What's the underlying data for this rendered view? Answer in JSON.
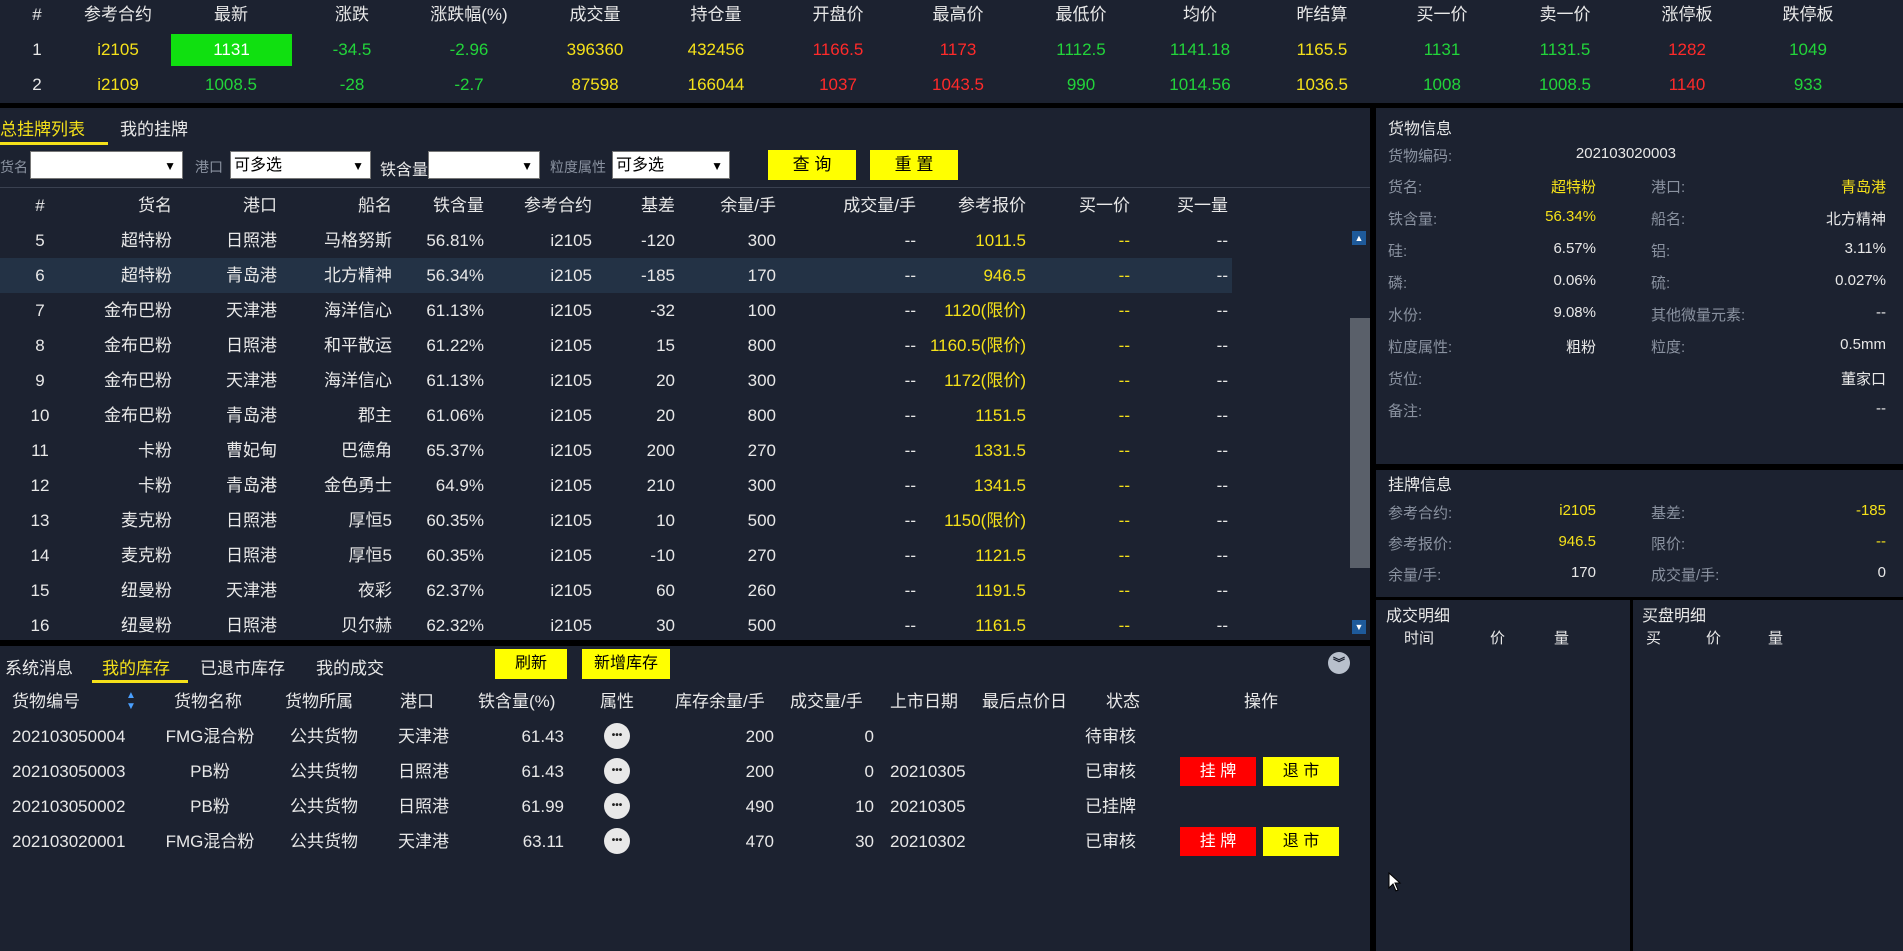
{
  "market": {
    "headers": [
      "#",
      "参考合约",
      "最新",
      "涨跌",
      "涨跌幅(%)",
      "成交量",
      "持仓量",
      "开盘价",
      "最高价",
      "最低价",
      "均价",
      "昨结算",
      "买一价",
      "卖一价",
      "涨停板",
      "跌停板"
    ],
    "rows": [
      [
        "1",
        "i2105",
        "1131",
        "-34.5",
        "-2.96",
        "396360",
        "432456",
        "1166.5",
        "1173",
        "1112.5",
        "1141.18",
        "1165.5",
        "1131",
        "1131.5",
        "1282",
        "1049"
      ],
      [
        "2",
        "i2109",
        "1008.5",
        "-28",
        "-2.7",
        "87598",
        "166044",
        "1037",
        "1043.5",
        "990",
        "1014.56",
        "1036.5",
        "1008",
        "1008.5",
        "1140",
        "933"
      ]
    ]
  },
  "listing": {
    "tabs": [
      "总挂牌列表",
      "我的挂牌"
    ],
    "filters": {
      "goods_label": "货名",
      "port_label": "港口",
      "port_value": "可多选",
      "iron_label": "铁含量",
      "grain_label": "粒度属性",
      "grain_value": "可多选",
      "query": "查 询",
      "reset": "重 置"
    },
    "headers": [
      "#",
      "货名",
      "港口",
      "船名",
      "铁含量",
      "参考合约",
      "基差",
      "余量/手",
      "成交量/手",
      "参考报价",
      "买一价",
      "买一量"
    ],
    "rows": [
      [
        "5",
        "超特粉",
        "日照港",
        "马格努斯",
        "56.81%",
        "i2105",
        "-120",
        "300",
        "--",
        "1011.5",
        "--",
        "--"
      ],
      [
        "6",
        "超特粉",
        "青岛港",
        "北方精神",
        "56.34%",
        "i2105",
        "-185",
        "170",
        "--",
        "946.5",
        "--",
        "--"
      ],
      [
        "7",
        "金布巴粉",
        "天津港",
        "海洋信心",
        "61.13%",
        "i2105",
        "-32",
        "100",
        "--",
        "1120(限价)",
        "--",
        "--"
      ],
      [
        "8",
        "金布巴粉",
        "日照港",
        "和平散运",
        "61.22%",
        "i2105",
        "15",
        "800",
        "--",
        "1160.5(限价)",
        "--",
        "--"
      ],
      [
        "9",
        "金布巴粉",
        "天津港",
        "海洋信心",
        "61.13%",
        "i2105",
        "20",
        "300",
        "--",
        "1172(限价)",
        "--",
        "--"
      ],
      [
        "10",
        "金布巴粉",
        "青岛港",
        "郡主",
        "61.06%",
        "i2105",
        "20",
        "800",
        "--",
        "1151.5",
        "--",
        "--"
      ],
      [
        "11",
        "卡粉",
        "曹妃甸港",
        "巴德角",
        "65.37%",
        "i2105",
        "200",
        "270",
        "--",
        "1331.5",
        "--",
        "--"
      ],
      [
        "12",
        "卡粉",
        "青岛港",
        "金色勇士",
        "64.9%",
        "i2105",
        "210",
        "300",
        "--",
        "1341.5",
        "--",
        "--"
      ],
      [
        "13",
        "麦克粉",
        "日照港",
        "厚恒5",
        "60.35%",
        "i2105",
        "10",
        "500",
        "--",
        "1150(限价)",
        "--",
        "--"
      ],
      [
        "14",
        "麦克粉",
        "日照港",
        "厚恒5",
        "60.35%",
        "i2105",
        "-10",
        "270",
        "--",
        "1121.5",
        "--",
        "--"
      ],
      [
        "15",
        "纽曼粉",
        "天津港",
        "夜彩",
        "62.37%",
        "i2105",
        "60",
        "260",
        "--",
        "1191.5",
        "--",
        "--"
      ],
      [
        "16",
        "纽曼粉",
        "日照港",
        "贝尔赫",
        "62.32%",
        "i2105",
        "30",
        "500",
        "--",
        "1161.5",
        "--",
        "--"
      ]
    ]
  },
  "bottom": {
    "tabs": [
      "系统消息",
      "我的库存",
      "已退市库存",
      "我的成交"
    ],
    "refresh": "刷新",
    "add": "新增库存",
    "headers": [
      "货物编号",
      "货物名称",
      "货物所属",
      "港口",
      "铁含量(%)",
      "属性",
      "库存余量/手",
      "成交量/手",
      "上市日期",
      "最后点价日",
      "状态",
      "操作"
    ],
    "rows": [
      [
        "202103050004",
        "FMG混合粉",
        "公共货物",
        "天津港",
        "61.43",
        "200",
        "0",
        "",
        "",
        "待审核",
        false
      ],
      [
        "202103050003",
        "PB粉",
        "公共货物",
        "日照港",
        "61.43",
        "200",
        "0",
        "20210305",
        "",
        "已审核",
        true
      ],
      [
        "202103050002",
        "PB粉",
        "公共货物",
        "日照港",
        "61.99",
        "490",
        "10",
        "20210305",
        "",
        "已挂牌",
        false
      ],
      [
        "202103020001",
        "FMG混合粉",
        "公共货物",
        "天津港",
        "63.11",
        "470",
        "30",
        "20210302",
        "",
        "已审核",
        true
      ]
    ],
    "list_btn": "挂 牌",
    "delist_btn": "退 市"
  },
  "goods_info": {
    "title": "货物信息",
    "code_label": "货物编码:",
    "code": "202103020003",
    "name_label": "货名:",
    "name": "超特粉",
    "port_label": "港口:",
    "port": "青岛港",
    "iron_label": "铁含量:",
    "iron": "56.34%",
    "ship_label": "船名:",
    "ship": "北方精神",
    "si_label": "硅:",
    "si": "6.57%",
    "al_label": "铝:",
    "al": "3.11%",
    "p_label": "磷:",
    "p": "0.06%",
    "s_label": "硫:",
    "s": "0.027%",
    "water_label": "水份:",
    "water": "9.08%",
    "trace_label": "其他微量元素:",
    "trace": "--",
    "grain_attr_label": "粒度属性:",
    "grain_attr": "粗粉",
    "grain_label": "粒度:",
    "grain": "0.5mm",
    "loc_label": "货位:",
    "loc": "董家口",
    "note_label": "备注:",
    "note": "--"
  },
  "listing_info": {
    "title": "挂牌信息",
    "contract_label": "参考合约:",
    "contract": "i2105",
    "basis_label": "基差:",
    "basis": "-185",
    "price_label": "参考报价:",
    "price": "946.5",
    "limit_label": "限价:",
    "limit": "--",
    "remain_label": "余量/手:",
    "remain": "170",
    "deal_label": "成交量/手:",
    "deal": "0"
  },
  "trade_detail": {
    "title": "成交明细",
    "cols": [
      "时间",
      "价",
      "量"
    ]
  },
  "buy_detail": {
    "title": "买盘明细",
    "cols": [
      "买",
      "价",
      "量"
    ]
  },
  "colors": {
    "up": "#ff2a2a",
    "down": "#22d43a",
    "highlight": "#f5e11a",
    "button": "#ffff00",
    "danger": "#ff0000"
  }
}
